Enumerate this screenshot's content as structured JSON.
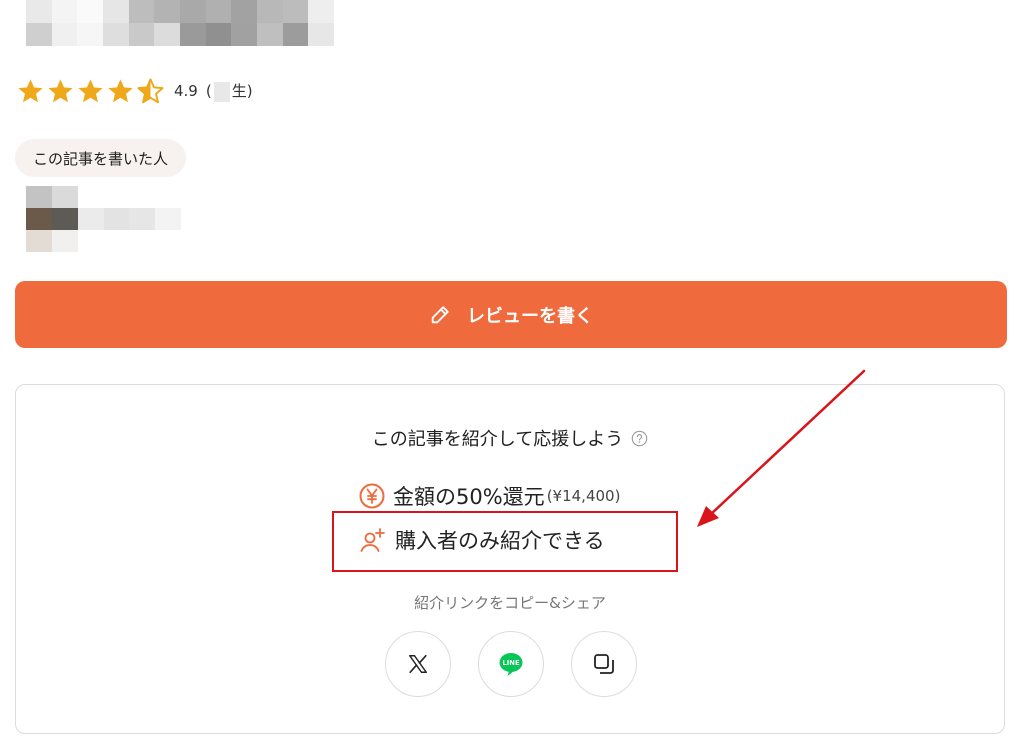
{
  "rating": {
    "stars": 4.5,
    "value": "4.9",
    "paren_open": "(",
    "count_suffix": "生)"
  },
  "author": {
    "badge_label": "この記事を書いた人"
  },
  "review_button": {
    "label": "レビューを書く",
    "icon": "pencil-icon",
    "color": "#ef6a3d"
  },
  "referral": {
    "title": "この記事を紹介して応援しよう",
    "help_icon": "question-circle-icon",
    "reward_text": "金額の50%還元",
    "reward_amount": "(¥14,400)",
    "reward_icon": "yen-circle-icon",
    "buyers_only_text": "購入者のみ紹介できる",
    "buyers_icon": "user-plus-icon",
    "copy_share_label": "紹介リンクをコピー&シェア",
    "share_buttons": [
      {
        "name": "x-icon"
      },
      {
        "name": "line-icon",
        "label": "LINE"
      },
      {
        "name": "copy-icon"
      }
    ],
    "accent_color": "#ef6a3d",
    "annotation_color": "#d9141b"
  }
}
